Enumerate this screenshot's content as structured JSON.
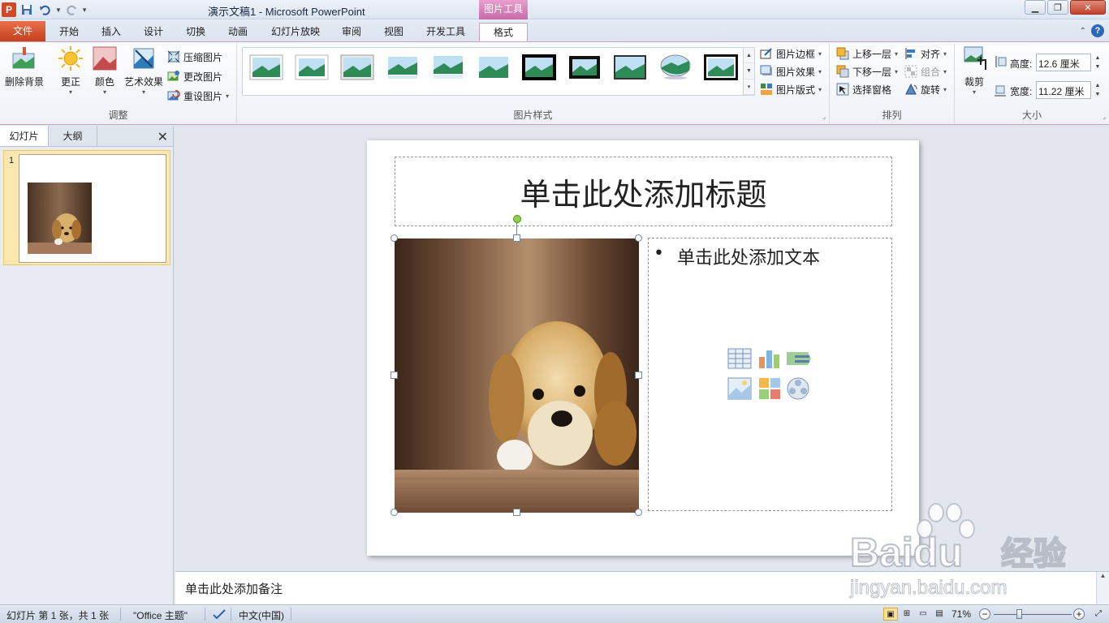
{
  "window": {
    "title": "演示文稿1  -  Microsoft PowerPoint",
    "contextual_tab_group": "图片工具"
  },
  "tabs": [
    {
      "label": "文件"
    },
    {
      "label": "开始"
    },
    {
      "label": "插入"
    },
    {
      "label": "设计"
    },
    {
      "label": "切换"
    },
    {
      "label": "动画"
    },
    {
      "label": "幻灯片放映"
    },
    {
      "label": "审阅"
    },
    {
      "label": "视图"
    },
    {
      "label": "开发工具"
    },
    {
      "label": "格式"
    }
  ],
  "ribbon": {
    "adjust": {
      "label": "调整",
      "remove_bg": "删除背景",
      "corrections": "更正",
      "color": "颜色",
      "artistic": "艺术效果",
      "compress": "压缩图片",
      "change": "更改图片",
      "reset": "重设图片"
    },
    "styles": {
      "label": "图片样式",
      "border": "图片边框",
      "effects": "图片效果",
      "layout": "图片版式"
    },
    "arrange": {
      "label": "排列",
      "bring_forward": "上移一层",
      "send_backward": "下移一层",
      "selection_pane": "选择窗格",
      "align": "对齐",
      "group": "组合",
      "rotate": "旋转"
    },
    "size": {
      "label": "大小",
      "crop": "裁剪",
      "height_label": "高度:",
      "height_value": "12.6 厘米",
      "width_label": "宽度:",
      "width_value": "11.22 厘米"
    }
  },
  "left_pane": {
    "tabs": [
      "幻灯片",
      "大纲"
    ],
    "slide_number": "1"
  },
  "slide": {
    "title_placeholder": "单击此处添加标题",
    "text_placeholder": "单击此处添加文本",
    "bullet": "•"
  },
  "notes": {
    "placeholder": "单击此处添加备注"
  },
  "status": {
    "slide_info": "幻灯片 第 1 张，共 1 张",
    "theme": "\"Office 主题\"",
    "language": "中文(中国)",
    "zoom": "71%"
  },
  "watermark": {
    "brand": "Baidu",
    "brand_cn": "经验",
    "url": "jingyan.baidu.com"
  },
  "colors": {
    "file_tab": "#d24726",
    "contextual": "#c76aa6",
    "selection_fill": "#fbe8b0"
  }
}
